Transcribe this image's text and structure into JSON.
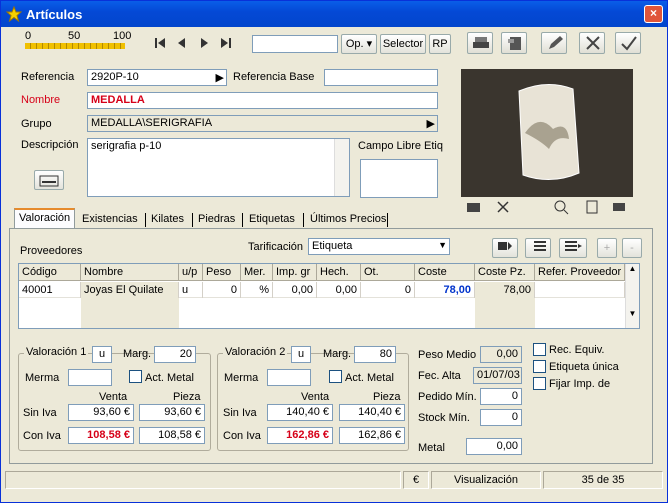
{
  "window": {
    "title": "Artículos",
    "close": "×"
  },
  "zoom": {
    "ticks": [
      "0",
      "50",
      "100"
    ]
  },
  "toolbar": {
    "op_label": "Op.",
    "selector_label": "Selector",
    "rp_label": "RP"
  },
  "form": {
    "referencia_label": "Referencia",
    "referencia_value": "2920P-10",
    "referencia_base_label": "Referencia Base",
    "referencia_base_value": "",
    "nombre_label": "Nombre",
    "nombre_value": "MEDALLA",
    "grupo_label": "Grupo",
    "grupo_value": "MEDALLA\\SERIGRAFIA",
    "descripcion_label": "Descripción",
    "descripcion_value": "serigrafia p-10",
    "campo_libre_label": "Campo Libre Etiq",
    "campo_libre_value": ""
  },
  "tabs": [
    "Valoración",
    "Existencias",
    "Kilates",
    "Piedras",
    "Etiquetas",
    "Últimos Precios"
  ],
  "valoracion": {
    "proveedores_label": "Proveedores",
    "tarificacion_label": "Tarificación",
    "tarificacion_value": "Etiqueta",
    "columns": [
      "Código",
      "Nombre",
      "u/p",
      "Peso",
      "Mer.",
      "Imp. gr",
      "Hech.",
      "Ot.",
      "Coste",
      "Coste Pz.",
      "Refer. Proveedor"
    ],
    "rows": [
      [
        "40001",
        "Joyas El Quilate",
        "u",
        "0",
        "%",
        "0,00",
        "0,00",
        "0",
        "78,00",
        "78,00",
        ""
      ]
    ]
  },
  "val1": {
    "caption": "Valoración 1",
    "unit": "u",
    "marg_label": "Marg.",
    "marg_value": "20",
    "merma_label": "Merma",
    "merma_value": "",
    "act_metal_label": "Act. Metal",
    "venta_label": "Venta",
    "pieza_label": "Pieza",
    "sin_iva_label": "Sin Iva",
    "sin_iva_venta": "93,60 €",
    "sin_iva_pieza": "93,60 €",
    "con_iva_label": "Con Iva",
    "con_iva_venta": "108,58 €",
    "con_iva_pieza": "108,58 €"
  },
  "val2": {
    "caption": "Valoración 2",
    "unit": "u",
    "marg_label": "Marg.",
    "marg_value": "80",
    "merma_label": "Merma",
    "merma_value": "",
    "act_metal_label": "Act. Metal",
    "venta_label": "Venta",
    "pieza_label": "Pieza",
    "sin_iva_label": "Sin Iva",
    "sin_iva_venta": "140,40 €",
    "sin_iva_pieza": "140,40 €",
    "con_iva_label": "Con Iva",
    "con_iva_venta": "162,86 €",
    "con_iva_pieza": "162,86 €"
  },
  "right": {
    "peso_medio_label": "Peso Medio",
    "peso_medio_value": "0,00",
    "fec_alta_label": "Fec. Alta",
    "fec_alta_value": "01/07/03",
    "pedido_min_label": "Pedido Mín.",
    "pedido_min_value": "0",
    "stock_min_label": "Stock Mín.",
    "stock_min_value": "0",
    "metal_label": "Metal",
    "metal_value": "0,00",
    "rec_equiv_label": "Rec. Equiv.",
    "etiqueta_unica_label": "Etiqueta única",
    "fijar_imp_label": "Fijar Imp. de"
  },
  "status": {
    "currency": "€",
    "mode": "Visualización",
    "record": "35 de 35"
  },
  "colors": {
    "accent_red": "#d60018",
    "accent_blue": "#0033cc",
    "title_blue": "#0449d6"
  }
}
